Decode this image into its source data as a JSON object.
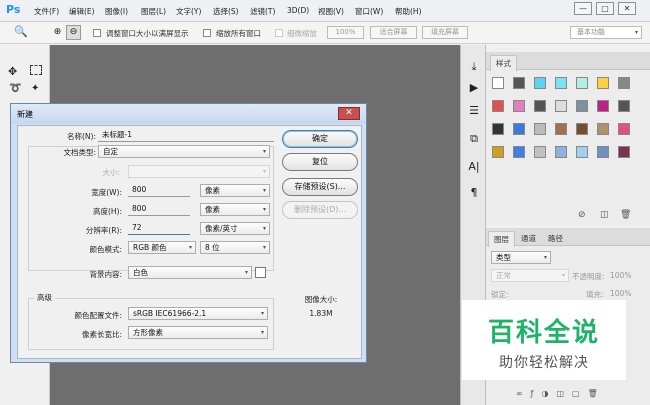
{
  "app": {
    "logo": "Ps"
  },
  "menu": [
    "文件(F)",
    "编辑(E)",
    "图像(I)",
    "图层(L)",
    "文字(Y)",
    "选择(S)",
    "滤镜(T)",
    "3D(D)",
    "视图(V)",
    "窗口(W)",
    "帮助(H)"
  ],
  "window_controls": {
    "minimize": "—",
    "maximize": "□",
    "close": "✕"
  },
  "options_bar": {
    "resize_windows": "调整窗口大小以满屏显示",
    "zoom_all": "缩放所有窗口",
    "scrubby_zoom": "细微缩放",
    "zoom_100": "100%",
    "fit_screen": "适合屏幕",
    "fill_screen": "填充屏幕",
    "workspace": "基本功能"
  },
  "swatches_panel": {
    "tab": "样式",
    "colors": [
      "#ffffff",
      "#555555",
      "#5fd3ee",
      "#7fe0f0",
      "#b0f0e8",
      "#ffd040",
      "#888888",
      "#e05050",
      "#e080c0",
      "#555555",
      "#dddddd",
      "#8090a0",
      "#c0208a",
      "#555555",
      "#333333",
      "#3a7bd5",
      "#bbbbbb",
      "#a07050",
      "#705030",
      "#b09070",
      "#e05080",
      "#d0a020",
      "#4080e0",
      "#c0c0c0",
      "#90b0e0",
      "#a0d0f0",
      "#7090c0",
      "#803050"
    ]
  },
  "layers_panel": {
    "tabs": [
      "图层",
      "通道",
      "路径"
    ],
    "kind": "类型",
    "blend": "正常",
    "opacity_label": "不透明度:",
    "opacity": "100%",
    "lock_label": "锁定:",
    "fill_label": "填充:",
    "fill": "100%"
  },
  "dialog": {
    "title": "新建",
    "name_label": "名称(N):",
    "name_value": "未标题-1",
    "doc_type_label": "文档类型:",
    "doc_type_value": "自定",
    "size_label": "大小:",
    "width_label": "宽度(W):",
    "width_value": "800",
    "width_unit": "像素",
    "height_label": "高度(H):",
    "height_value": "800",
    "height_unit": "像素",
    "resolution_label": "分辨率(R):",
    "resolution_value": "72",
    "resolution_unit": "像素/英寸",
    "color_mode_label": "颜色模式:",
    "color_mode_value": "RGB 颜色",
    "bit_depth_value": "8 位",
    "background_label": "背景内容:",
    "background_value": "白色",
    "advanced_label": "高级",
    "color_profile_label": "颜色配置文件:",
    "color_profile_value": "sRGB IEC61966-2.1",
    "pixel_aspect_label": "像素长宽比:",
    "pixel_aspect_value": "方形像素",
    "image_size_label": "图像大小:",
    "image_size_value": "1.83M",
    "buttons": {
      "ok": "确定",
      "reset": "复位",
      "save_preset": "存储预设(S)...",
      "delete_preset": "删除预设(D)..."
    },
    "close": "✕"
  },
  "watermark": {
    "title": "百科全说",
    "subtitle": "助你轻松解决"
  }
}
